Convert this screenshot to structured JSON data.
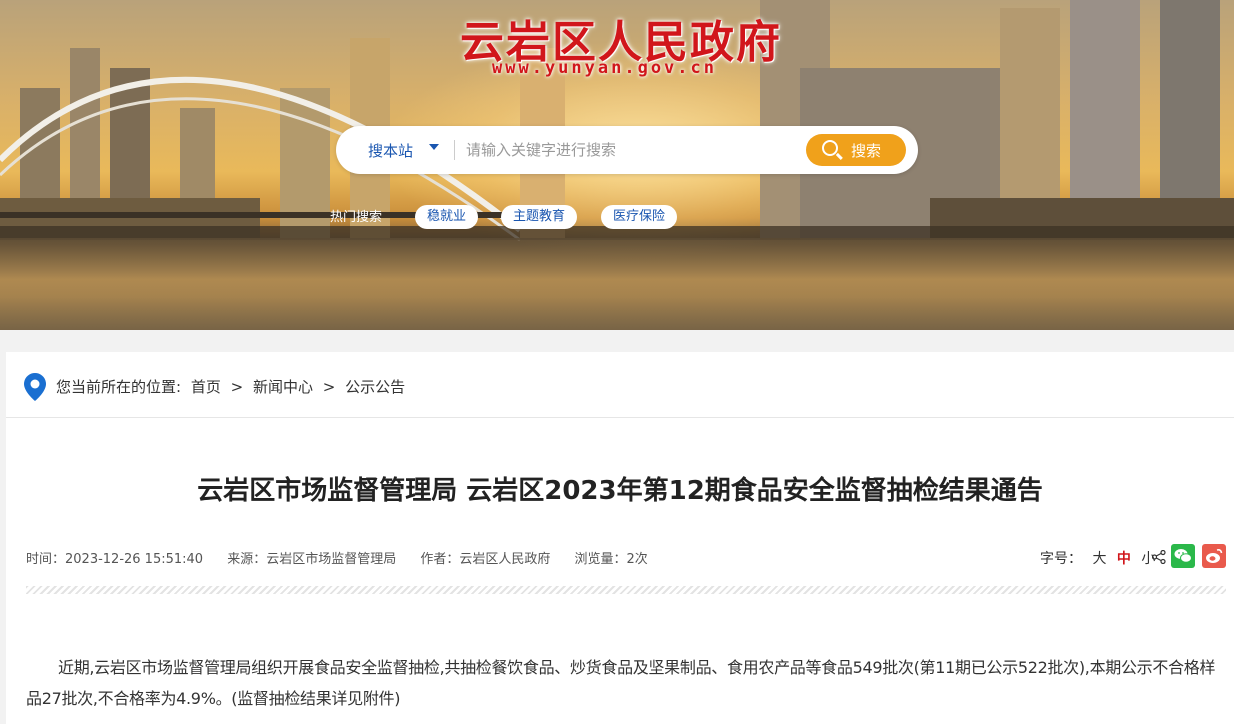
{
  "header": {
    "site_title": "云岩区人民政府",
    "site_domain": "www.yunyan.gov.cn",
    "brand_color": "#d1161b"
  },
  "search": {
    "scope_label": "搜本站",
    "placeholder": "请输入关键字进行搜索",
    "button_label": "搜索",
    "hot_label": "热门搜索",
    "hot_tags": [
      "稳就业",
      "主题教育",
      "医疗保险"
    ],
    "accent_color": "#f0a11b"
  },
  "breadcrumb": {
    "prefix": "您当前所在的位置:",
    "items": [
      "首页",
      "新闻中心",
      "公示公告"
    ],
    "separator": ">"
  },
  "article": {
    "title": "云岩区市场监督管理局 云岩区2023年第12期食品安全监督抽检结果通告",
    "meta": {
      "time": "时间：2023-12-26 15:51:40",
      "source": "来源：云岩区市场监督管理局",
      "author": "作者：云岩区人民政府",
      "views": "浏览量：2次"
    },
    "font_size": {
      "label": "字号：",
      "options": [
        "大",
        "中",
        "小"
      ],
      "selected": "中"
    },
    "share_icons": [
      "share-icon",
      "wechat-icon",
      "weibo-icon"
    ],
    "body": "近期,云岩区市场监督管理局组织开展食品安全监督抽检,共抽检餐饮食品、炒货食品及坚果制品、食用农产品等食品549批次(第11期已公示522批次),本期公示不合格样品27批次,不合格率为4.9%。(监督抽检结果详见附件)"
  }
}
